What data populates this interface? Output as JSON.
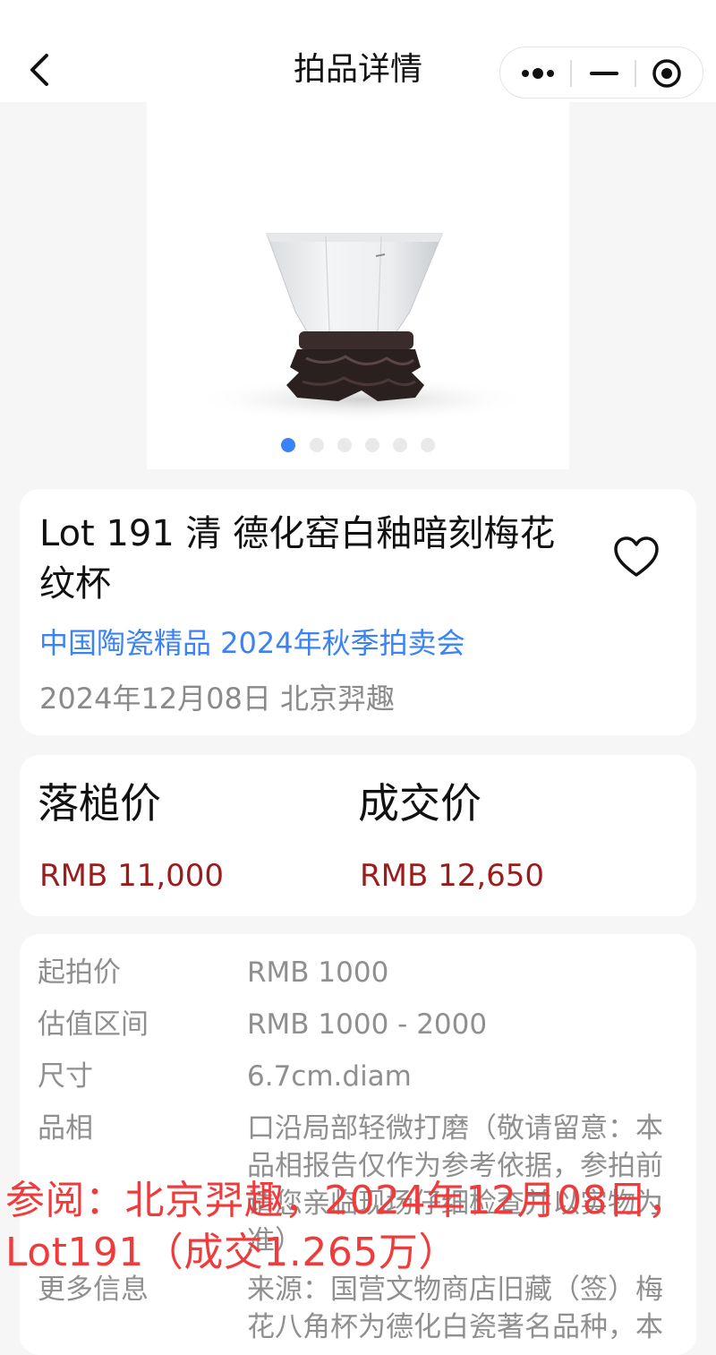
{
  "nav": {
    "title": "拍品详情"
  },
  "gallery": {
    "total_images": 6,
    "active_index": 0
  },
  "lot": {
    "title": "Lot 191 清 德化窑白釉暗刻梅花纹杯",
    "sale_name": "中国陶瓷精品 2024年秋季拍卖会",
    "sale_date": "2024年12月08日 北京羿趣"
  },
  "prices": {
    "hammer_label": "落槌价",
    "hammer_value": "RMB 11,000",
    "final_label": "成交价",
    "final_value": "RMB 12,650"
  },
  "details": {
    "rows": [
      {
        "label": "起拍价",
        "value": "RMB 1000"
      },
      {
        "label": "估值区间",
        "value": "RMB 1000 - 2000"
      },
      {
        "label": "尺寸",
        "value": "6.7cm.diam"
      },
      {
        "label": "品相",
        "value": "口沿局部轻微打磨（敬请留意：本品相报告仅作为参考依据，参拍前请您亲临现场仔细检查并以实物为准）"
      },
      {
        "label": "更多信息",
        "value": "来源：国营文物商店旧藏（签）梅花八角杯为德化白瓷著名品种，本"
      }
    ]
  },
  "watermark": {
    "line1": "参阅：北京羿趣，2024年12月08日，",
    "line2": "Lot191（成交1.265万）"
  },
  "colors": {
    "accent": "#3b82f6",
    "price": "#9b1c1c",
    "watermark": "#ef3b3b"
  }
}
